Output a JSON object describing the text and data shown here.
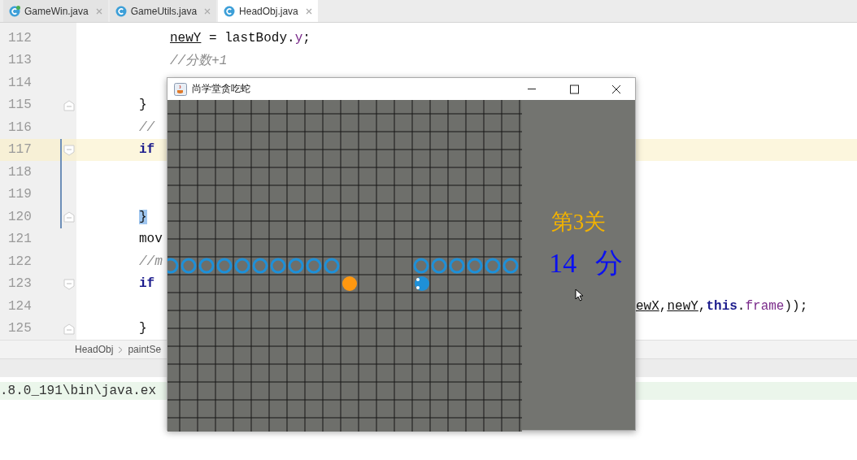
{
  "tabs": [
    {
      "label": "GameWin.java",
      "selected": false,
      "badge": true
    },
    {
      "label": "GameUtils.java",
      "selected": false,
      "badge": false
    },
    {
      "label": "HeadObj.java",
      "selected": true,
      "badge": false
    }
  ],
  "editor": {
    "lines": [
      {
        "number": "112",
        "kind": "deep",
        "current": false,
        "changed": false,
        "fold_start": false,
        "fold_end": false,
        "segments": [
          {
            "kind": "local",
            "text": "newY"
          },
          {
            "kind": "plain",
            "text": " = lastBody."
          },
          {
            "kind": "field",
            "text": "y"
          },
          {
            "kind": "plain",
            "text": ";"
          }
        ]
      },
      {
        "number": "113",
        "kind": "deep",
        "current": false,
        "changed": false,
        "fold_start": false,
        "fold_end": false,
        "segments": [
          {
            "kind": "comment",
            "text": "//分数+1"
          }
        ]
      },
      {
        "number": "114",
        "current": false,
        "changed": false,
        "fold_start": false,
        "fold_end": false
      },
      {
        "number": "115",
        "kind": "nested",
        "current": false,
        "changed": false,
        "fold_start": false,
        "fold_end": true,
        "segments": [
          {
            "kind": "plain",
            "text": "}"
          }
        ]
      },
      {
        "number": "116",
        "kind": "nested",
        "current": false,
        "changed": false,
        "fold_start": false,
        "fold_end": false,
        "segments": [
          {
            "kind": "comment",
            "text": "//"
          }
        ]
      },
      {
        "number": "117",
        "kind": "nested",
        "current": true,
        "changed": true,
        "fold_start": true,
        "fold_end": false,
        "segments": [
          {
            "kind": "keyword",
            "text": "if"
          }
        ]
      },
      {
        "number": "118",
        "current": false,
        "changed": true,
        "fold_start": false,
        "fold_end": false
      },
      {
        "number": "119",
        "current": false,
        "changed": true,
        "fold_start": false,
        "fold_end": false
      },
      {
        "number": "120",
        "kind": "nested",
        "current": false,
        "changed": true,
        "fold_start": false,
        "fold_end": true,
        "segments": [
          {
            "kind": "match",
            "text": "}"
          }
        ]
      },
      {
        "number": "121",
        "kind": "nested",
        "current": false,
        "changed": false,
        "fold_start": false,
        "fold_end": false,
        "segments": [
          {
            "kind": "plain",
            "text": "mov"
          }
        ]
      },
      {
        "number": "122",
        "kind": "nested",
        "current": false,
        "changed": false,
        "fold_start": false,
        "fold_end": false,
        "segments": [
          {
            "kind": "comment",
            "text": "//m"
          }
        ]
      },
      {
        "number": "123",
        "kind": "nested",
        "current": false,
        "changed": false,
        "fold_start": true,
        "fold_end": false,
        "segments": [
          {
            "kind": "keyword",
            "text": "if"
          }
        ]
      },
      {
        "number": "124",
        "kind": "tail",
        "current": false,
        "changed": false,
        "fold_start": false,
        "fold_end": false,
        "segments": [
          {
            "kind": "local",
            "text": "ewX"
          },
          {
            "kind": "plain",
            "text": ","
          },
          {
            "kind": "local",
            "text": "newY"
          },
          {
            "kind": "plain",
            "text": ","
          },
          {
            "kind": "keyword",
            "text": "this"
          },
          {
            "kind": "plain",
            "text": "."
          },
          {
            "kind": "field",
            "text": "frame"
          },
          {
            "kind": "plain",
            "text": "));"
          }
        ]
      },
      {
        "number": "125",
        "kind": "nested",
        "current": false,
        "changed": false,
        "fold_start": false,
        "fold_end": true,
        "segments": [
          {
            "kind": "plain",
            "text": "}"
          }
        ]
      }
    ]
  },
  "breadcrumb": [
    "HeadObj",
    "paintSe"
  ],
  "console": {
    "lines": [
      ".8.0_191\\bin\\java.ex"
    ]
  },
  "game_window": {
    "title": "尚学堂贪吃蛇",
    "level_text": "第3关",
    "score_text": "14 分"
  }
}
